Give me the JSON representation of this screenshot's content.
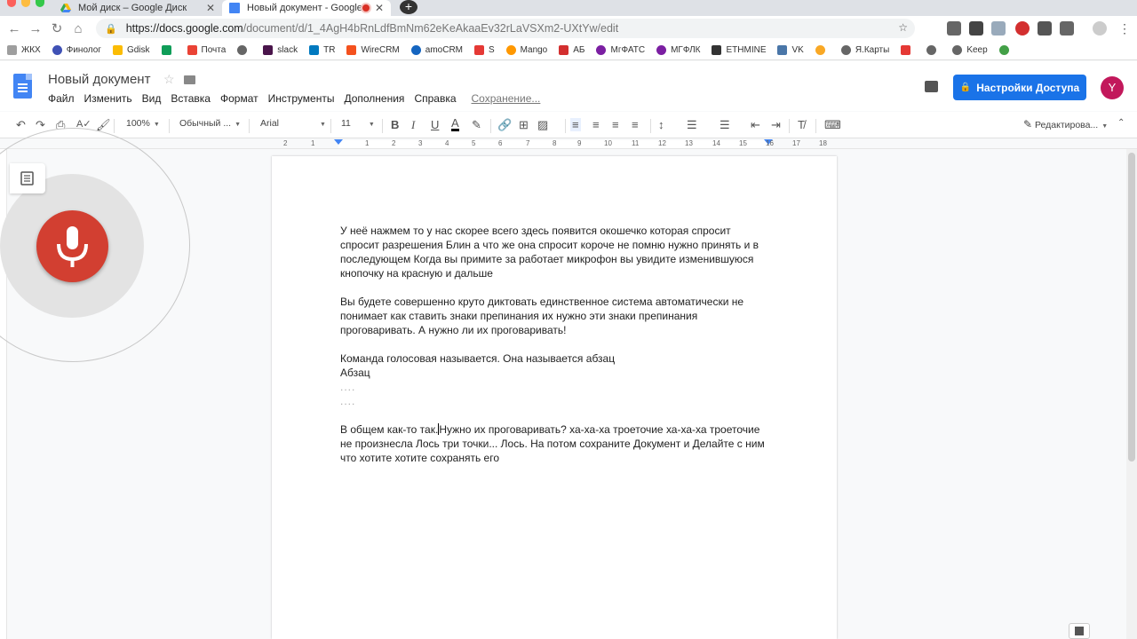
{
  "browser": {
    "tabs": [
      {
        "title": "Мой диск – Google Диск",
        "active": false
      },
      {
        "title": "Новый документ - Google",
        "active": true
      }
    ],
    "url_host": "https://docs.google.com",
    "url_path": "/document/d/1_4AgH4bRnLdfBmNm62eKeAkaaEv32rLaVSXm2-UXtYw/edit",
    "bookmarks": [
      "ЖКХ",
      "Финолог",
      "Gdisk",
      "Почта",
      "slack",
      "TR",
      "WireCRM",
      "amoCRM",
      "S",
      "Mango",
      "АБ",
      "МгФАТС",
      "МГФЛК",
      "ETHMINE",
      "VK",
      "Я.Карты",
      "Keep"
    ]
  },
  "docs": {
    "title": "Новый документ",
    "menu": [
      "Файл",
      "Изменить",
      "Вид",
      "Вставка",
      "Формат",
      "Инструменты",
      "Дополнения",
      "Справка"
    ],
    "saving_status": "Сохранение...",
    "share_label": "Настройки Доступа",
    "avatar_letter": "Y"
  },
  "toolbar": {
    "zoom": "100%",
    "style": "Обычный ...",
    "font": "Arial",
    "size": "11",
    "mode": "Редактирова..."
  },
  "ruler": [
    "2",
    "1",
    "1",
    "2",
    "3",
    "4",
    "5",
    "6",
    "7",
    "8",
    "9",
    "10",
    "11",
    "12",
    "13",
    "14",
    "15",
    "16",
    "17",
    "18"
  ],
  "document": {
    "p1": "У неё нажмем то у нас скорее всего здесь появится окошечко которая спросит спросит разрешения Блин а что же она спросит короче не помню нужно принять и в последующем Когда вы примите за работает микрофон вы увидите изменившуюся кнопочку на красную и дальше",
    "p2": "Вы будете совершенно круто диктовать единственное система автоматически не понимает как ставить знаки препинания их нужно эти знаки препинания проговаривать. А нужно ли их проговаривать!",
    "p3a": "Команда голосовая называется. Она называется абзац",
    "p3b": "Абзац",
    "dots1": "....",
    "dots2": "....",
    "p4a": "В общем как-то так.",
    "p4b": "Нужно их проговаривать? ха-ха-ха троеточие ха-ха-ха троеточие не произнесла Лось три точки... Лось. На потом сохраните Документ и Делайте с ним что хотите хотите сохранять его"
  }
}
